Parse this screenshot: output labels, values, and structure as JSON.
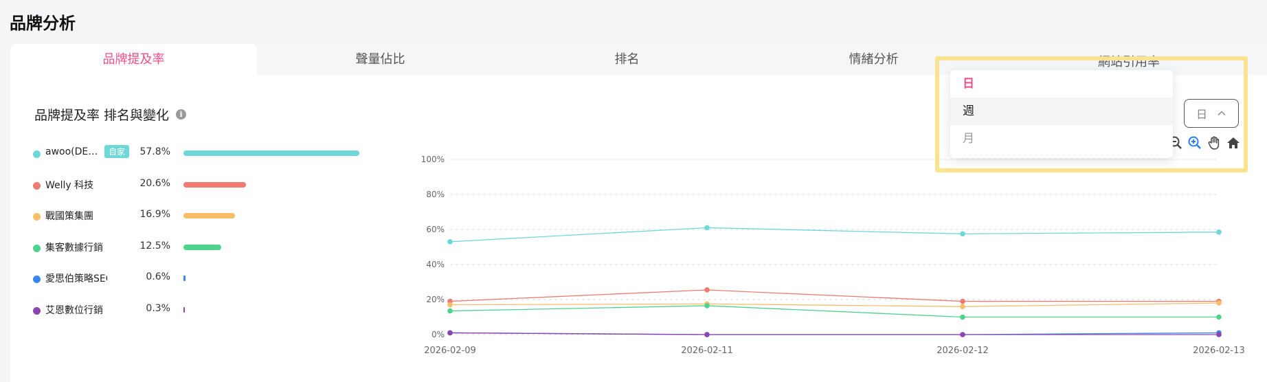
{
  "page": {
    "title": "品牌分析"
  },
  "tabs": [
    {
      "label": "品牌提及率",
      "active": true
    },
    {
      "label": "聲量佔比",
      "active": false
    },
    {
      "label": "排名",
      "active": false
    },
    {
      "label": "情緒分析",
      "active": false
    }
  ],
  "partial_tab_label": "網站引用率",
  "section": {
    "title": "品牌提及率 排名與變化",
    "info_icon": "info-icon"
  },
  "rank_list": [
    {
      "name": "awoo(DE…",
      "badge": "自家",
      "percent": "57.8%",
      "value": 57.8,
      "color": "#6ed8d8"
    },
    {
      "name": "Welly 科技",
      "badge": "",
      "percent": "20.6%",
      "value": 20.6,
      "color": "#ef7b72"
    },
    {
      "name": "戰國策集團",
      "badge": "",
      "percent": "16.9%",
      "value": 16.9,
      "color": "#f8bd68"
    },
    {
      "name": "集客數據行銷",
      "badge": "",
      "percent": "12.5%",
      "value": 12.5,
      "color": "#4ed38a"
    },
    {
      "name": "愛思伯策略SEO",
      "badge": "",
      "percent": "0.6%",
      "value": 0.6,
      "color": "#3a86f0"
    },
    {
      "name": "艾恩數位行銷",
      "badge": "",
      "percent": "0.3%",
      "value": 0.3,
      "color": "#8e44ad"
    }
  ],
  "toolbar": {
    "icons": [
      "zoom-out-icon",
      "zoom-in-icon",
      "pan-hand-icon",
      "home-icon"
    ]
  },
  "dropdown": {
    "options": [
      {
        "label": "日",
        "state": "selected"
      },
      {
        "label": "週",
        "state": "hover"
      },
      {
        "label": "月",
        "state": "disabled"
      }
    ]
  },
  "select": {
    "value": "日",
    "icon": "chevron-up-icon"
  },
  "colors": {
    "accent": "#ee4d8a",
    "highlight": "#fbe28f"
  },
  "chart_data": {
    "type": "line",
    "x": [
      "2026-02-09",
      "2026-02-11",
      "2026-02-12",
      "2026-02-13"
    ],
    "ylim": [
      0,
      100
    ],
    "yticks": [
      "0%",
      "20%",
      "40%",
      "60%",
      "80%",
      "100%"
    ],
    "grid": true,
    "series": [
      {
        "name": "awoo(DE…",
        "color": "#6ed8d8",
        "values": [
          53,
          61,
          57.5,
          58.5
        ]
      },
      {
        "name": "Welly 科技",
        "color": "#ef7b72",
        "values": [
          19,
          25.5,
          19,
          19
        ]
      },
      {
        "name": "戰國策集團",
        "color": "#f8bd68",
        "values": [
          17,
          17.5,
          16,
          18
        ]
      },
      {
        "name": "集客數據行銷",
        "color": "#4ed38a",
        "values": [
          13.5,
          16.5,
          10,
          10
        ]
      },
      {
        "name": "愛思伯策略SEO",
        "color": "#3a86f0",
        "values": [
          1,
          0,
          0,
          1
        ]
      },
      {
        "name": "艾恩數位行銷",
        "color": "#8e44ad",
        "values": [
          1,
          0,
          0,
          0
        ]
      }
    ]
  }
}
